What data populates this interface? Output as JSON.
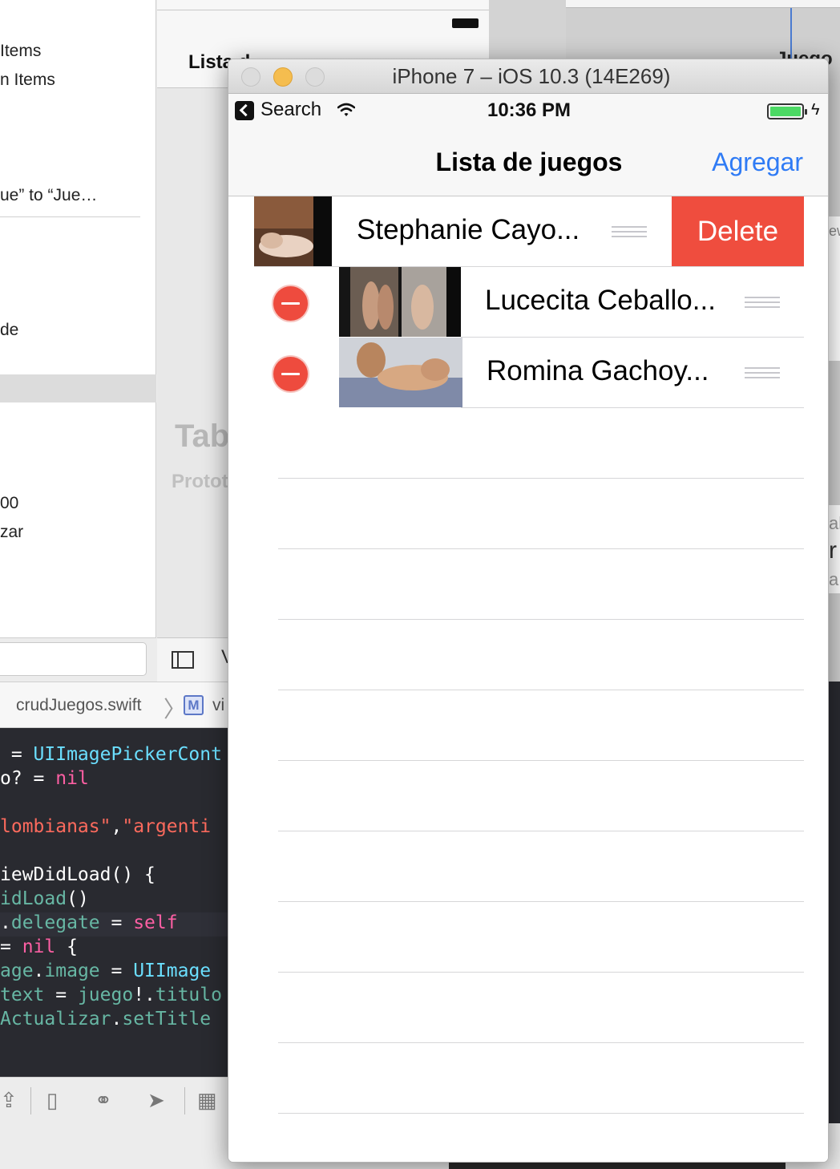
{
  "xcode": {
    "navigator_lines": [
      {
        "text": "Items"
      },
      {
        "text": "n Items"
      },
      {
        "text": "ue” to “Jue…"
      },
      {
        "text": "de"
      },
      {
        "text": "00"
      },
      {
        "text": "zar"
      }
    ],
    "scene_title_fragment": "Lista d",
    "canvas_label_table": "Tab",
    "canvas_label_prototype": "Protot",
    "right_scene_title_fragment": "Juego",
    "right_fragments": [
      "ew",
      "al",
      "r",
      "a"
    ],
    "canvas_bar_more": "V",
    "jumpbar": {
      "file": "crudJuegos.swift",
      "chevron": "〉",
      "badge": "M",
      "symbol": "vi"
    },
    "code_lines": [
      [
        {
          "t": " = ",
          "c": ""
        },
        {
          "t": "UIImagePickerCont",
          "c": "k-type"
        }
      ],
      [
        {
          "t": "o? = ",
          "c": ""
        },
        {
          "t": "nil",
          "c": "k-key"
        }
      ],
      [
        {
          "t": "",
          "c": ""
        }
      ],
      [
        {
          "t": "lombianas\"",
          "c": "k-str"
        },
        {
          "t": ",",
          "c": ""
        },
        {
          "t": "\"argenti",
          "c": "k-str"
        }
      ],
      [
        {
          "t": "",
          "c": ""
        }
      ],
      [
        {
          "t": "iewDidLoad() {",
          "c": ""
        }
      ],
      [
        {
          "t": "idLoad",
          "c": "k-fn"
        },
        {
          "t": "()",
          "c": ""
        }
      ],
      [
        {
          "t": ".",
          "c": ""
        },
        {
          "t": "delegate",
          "c": "k-prop"
        },
        {
          "t": " = ",
          "c": ""
        },
        {
          "t": "self",
          "c": "k-key"
        }
      ],
      [
        {
          "t": "= ",
          "c": ""
        },
        {
          "t": "nil",
          "c": "k-key"
        },
        {
          "t": " {",
          "c": ""
        }
      ],
      [
        {
          "t": "age",
          "c": "k-prop"
        },
        {
          "t": ".",
          "c": ""
        },
        {
          "t": "image",
          "c": "k-prop"
        },
        {
          "t": " = ",
          "c": ""
        },
        {
          "t": "UIImage",
          "c": "k-type"
        }
      ],
      [
        {
          "t": "text",
          "c": "k-prop"
        },
        {
          "t": " = ",
          "c": ""
        },
        {
          "t": "juego",
          "c": "k-prop"
        },
        {
          "t": "!.",
          "c": ""
        },
        {
          "t": "titulo",
          "c": "k-prop"
        }
      ],
      [
        {
          "t": "Actualizar",
          "c": "k-prop"
        },
        {
          "t": ".",
          "c": ""
        },
        {
          "t": "setTitle",
          "c": "k-fn"
        }
      ]
    ]
  },
  "simulator": {
    "window_title": "iPhone 7 – iOS 10.3 (14E269)",
    "status_bar": {
      "back_label": "Search",
      "time": "10:36 PM",
      "battery_level": 1.0,
      "charging_icon": "ϟ"
    },
    "navbar": {
      "title": "Lista de juegos",
      "right_button": "Agregar"
    },
    "rows": [
      {
        "label": "Stephanie Cayo...",
        "state": "swiped-delete",
        "action_label": "Delete"
      },
      {
        "label": "Lucecita Ceballo...",
        "state": "editing"
      },
      {
        "label": "Romina Gachoy...",
        "state": "editing"
      }
    ],
    "empty_rows": 10,
    "colors": {
      "accent": "#2f7bf5",
      "delete": "#ef4d3e",
      "battery": "#4cd964"
    }
  }
}
